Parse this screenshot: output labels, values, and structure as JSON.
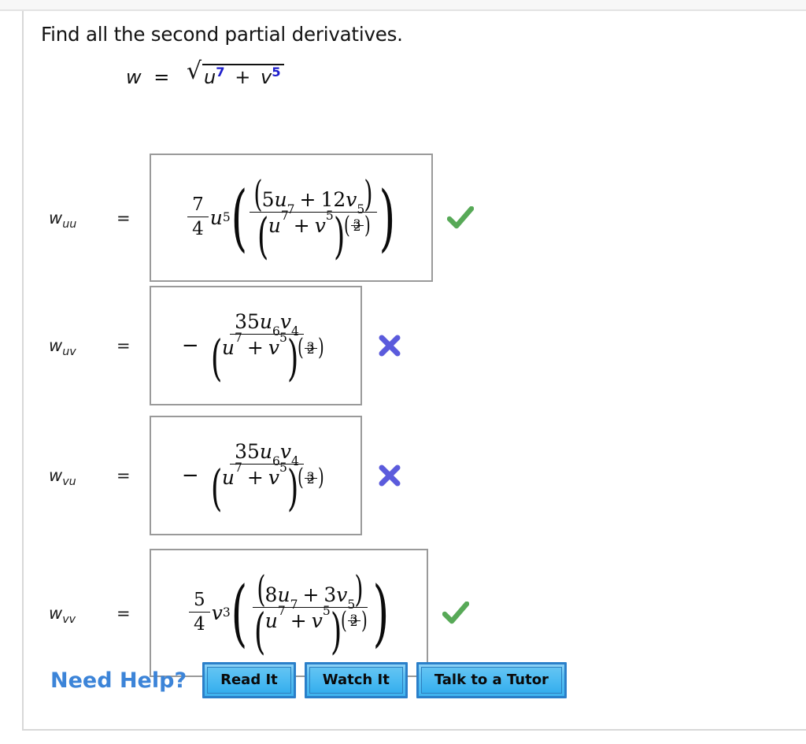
{
  "prompt": "Find all the second partial derivatives.",
  "given": {
    "lhs": "w",
    "equals": "=",
    "radicand_base1": "u",
    "radicand_exp1": "7",
    "plus": "+",
    "radicand_base2": "v",
    "radicand_exp2": "5",
    "radical_glyph": "√"
  },
  "colors": {
    "exponent_blue": "#2020cc",
    "correct_green": "#57a957",
    "incorrect_blue": "#5b5bdc",
    "need_help_blue": "#3c84d8",
    "button_border": "#2a7fc9",
    "box_border": "#9a9a9a"
  },
  "rows": [
    {
      "label_var": "w",
      "label_sub": "uu",
      "equals": "=",
      "kind": "coeff",
      "coeff_num": "7",
      "coeff_den": "4",
      "coeff_var": "u",
      "coeff_exp": "5",
      "num_c1": "5",
      "num_v1": "u",
      "num_e1": "7",
      "num_op": "+",
      "num_c2": "12",
      "num_v2": "v",
      "num_e2": "5",
      "den_v1": "u",
      "den_e1": "7",
      "den_op": "+",
      "den_v2": "v",
      "den_e2": "5",
      "den_pow_num": "3",
      "den_pow_den": "2",
      "status": "correct",
      "status_icon": "check-icon"
    },
    {
      "label_var": "w",
      "label_sub": "uv",
      "equals": "=",
      "kind": "negfrac",
      "lead_minus": "−",
      "num_c": "35",
      "num_v1": "u",
      "num_e1": "6",
      "num_v2": "v",
      "num_e2": "4",
      "den_v1": "u",
      "den_e1": "7",
      "den_op": "+",
      "den_v2": "v",
      "den_e2": "5",
      "den_pow_num": "3",
      "den_pow_den": "2",
      "status": "incorrect",
      "status_icon": "cross-icon"
    },
    {
      "label_var": "w",
      "label_sub": "vu",
      "equals": "=",
      "kind": "negfrac",
      "lead_minus": "−",
      "num_c": "35",
      "num_v1": "u",
      "num_e1": "6",
      "num_v2": "v",
      "num_e2": "4",
      "den_v1": "u",
      "den_e1": "7",
      "den_op": "+",
      "den_v2": "v",
      "den_e2": "5",
      "den_pow_num": "3",
      "den_pow_den": "2",
      "status": "incorrect",
      "status_icon": "cross-icon"
    },
    {
      "label_var": "w",
      "label_sub": "vv",
      "equals": "=",
      "kind": "coeff",
      "coeff_num": "5",
      "coeff_den": "4",
      "coeff_var": "v",
      "coeff_exp": "3",
      "num_c1": "8",
      "num_v1": "u",
      "num_e1": "7",
      "num_op": "+",
      "num_c2": "3",
      "num_v2": "v",
      "num_e2": "5",
      "den_v1": "u",
      "den_e1": "7",
      "den_op": "+",
      "den_v2": "v",
      "den_e2": "5",
      "den_pow_num": "3",
      "den_pow_den": "2",
      "status": "correct",
      "status_icon": "check-icon"
    }
  ],
  "need_help": {
    "label": "Need Help?",
    "buttons": [
      {
        "label": "Read It",
        "name": "read-it-button"
      },
      {
        "label": "Watch It",
        "name": "watch-it-button"
      },
      {
        "label": "Talk to a Tutor",
        "name": "talk-to-a-tutor-button"
      }
    ]
  }
}
